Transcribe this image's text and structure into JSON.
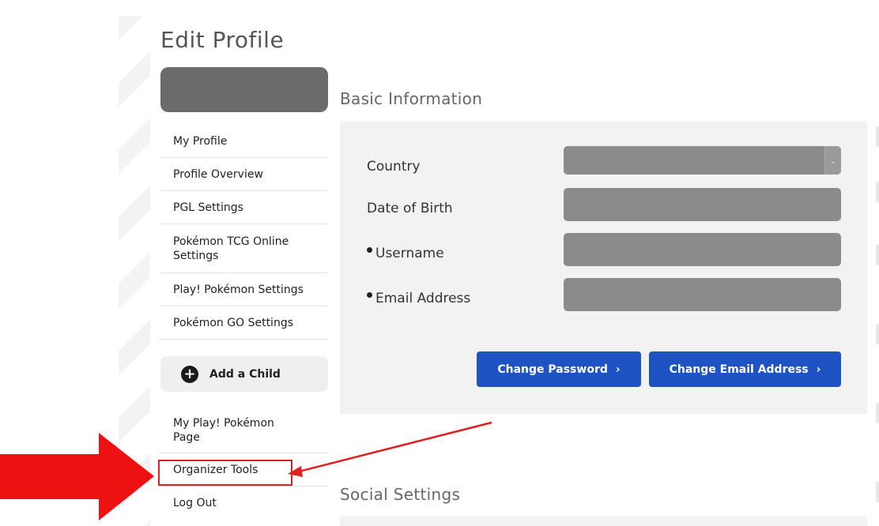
{
  "page": {
    "title": "Edit Profile"
  },
  "sidebar": {
    "items": [
      {
        "label": "My Profile"
      },
      {
        "label": "Profile Overview"
      },
      {
        "label": "PGL Settings"
      },
      {
        "label": "Pokémon TCG Online Settings"
      },
      {
        "label": "Play! Pokémon Settings"
      },
      {
        "label": "Pokémon GO Settings"
      }
    ],
    "add_child": {
      "label": "Add a Child",
      "icon": "plus-circle-icon"
    },
    "items2": [
      {
        "label": "My Play! Pokémon Page"
      },
      {
        "label": "Organizer Tools"
      },
      {
        "label": "Log Out"
      }
    ]
  },
  "basic_info": {
    "title": "Basic Information",
    "fields": {
      "country": {
        "label": "Country",
        "value": ""
      },
      "dob": {
        "label": "Date of Birth",
        "value": ""
      },
      "username": {
        "label": "Username",
        "value": ""
      },
      "email": {
        "label": "Email Address",
        "value": ""
      }
    },
    "buttons": {
      "change_password": "Change Password",
      "change_email": "Change Email Address"
    }
  },
  "social": {
    "title": "Social Settings"
  },
  "annotation": {
    "color": "#e02020",
    "icons": [
      "red-arrow-icon",
      "pointer-line"
    ]
  },
  "colors": {
    "primary_button": "#1f53c4",
    "panel_bg": "#f2f2f2",
    "field_bg": "#8b8b8b"
  }
}
